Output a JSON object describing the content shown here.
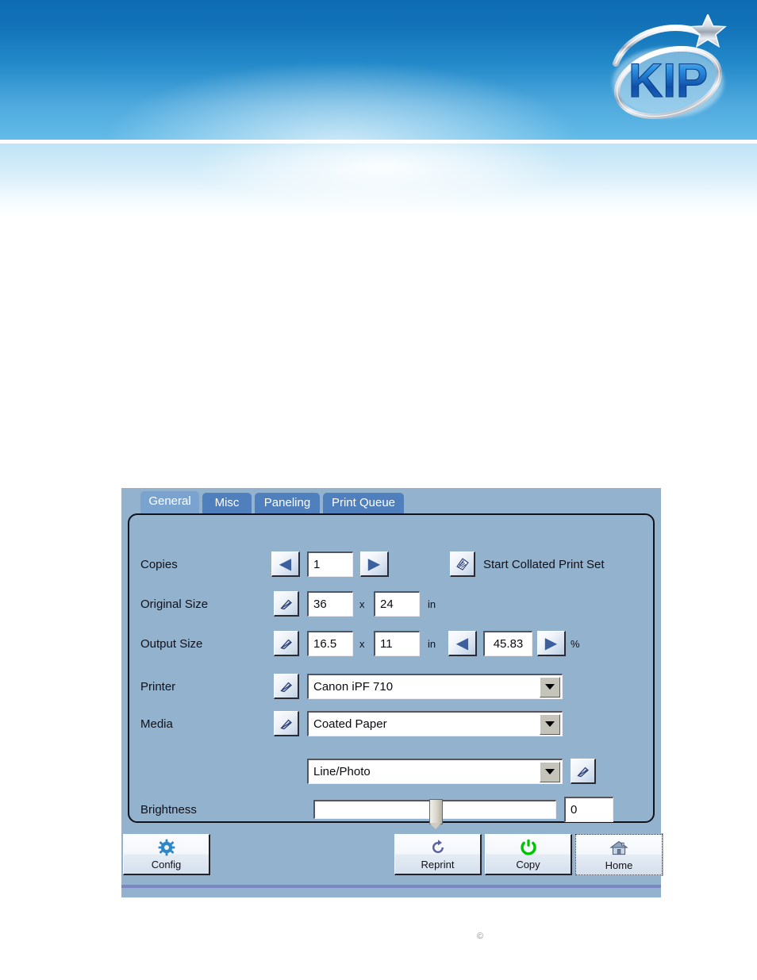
{
  "brand": {
    "logo_text": "KIP",
    "logo_name": "kip-logo"
  },
  "panel": {
    "tabs": [
      {
        "label": "General",
        "active": true
      },
      {
        "label": "Misc",
        "active": false
      },
      {
        "label": "Paneling",
        "active": false
      },
      {
        "label": "Print Queue",
        "active": false
      }
    ],
    "rows": {
      "copies": {
        "label": "Copies",
        "value": "1",
        "prev_icon": "left-arrow-icon",
        "next_icon": "right-arrow-icon",
        "collate_label": "Start Collated Print Set",
        "collate_icon": "stacked-pages-icon"
      },
      "original_size": {
        "label": "Original Size",
        "width": "36",
        "height": "24",
        "unit": "in",
        "separator": "x",
        "edit_icon": "pencil-edit-icon"
      },
      "output_size": {
        "label": "Output Size",
        "width": "16.5",
        "height": "11",
        "unit": "in",
        "separator": "x",
        "zoom": "45.83",
        "zoom_unit": "%",
        "edit_icon": "pencil-edit-icon",
        "dec_icon": "left-arrow-icon",
        "inc_icon": "right-arrow-icon"
      },
      "printer": {
        "label": "Printer",
        "value": "Canon iPF 710",
        "edit_icon": "pencil-edit-icon",
        "dropdown_icon": "chevron-down-icon"
      },
      "media": {
        "label": "Media",
        "value": "Coated Paper",
        "edit_icon": "pencil-edit-icon",
        "dropdown_icon": "chevron-down-icon"
      },
      "image_type": {
        "label": "",
        "value": "Line/Photo",
        "edit_icon": "pencil-edit-icon",
        "dropdown_icon": "chevron-down-icon"
      },
      "brightness": {
        "label": "Brightness",
        "value": "0",
        "slider_percent": 50
      }
    },
    "commands": [
      {
        "label": "Config",
        "icon": "gear-icon",
        "focused": false
      },
      {
        "label": "Reprint",
        "icon": "reprint-refresh-icon",
        "focused": false
      },
      {
        "label": "Copy",
        "icon": "copy-power-icon",
        "focused": false
      },
      {
        "label": "Home",
        "icon": "home-house-icon",
        "focused": true
      }
    ]
  },
  "footer": {
    "copyright_mark": "©"
  },
  "colors": {
    "banner_blue_dark": "#0d6cb4",
    "banner_blue_light": "#62bbe8",
    "panel_bg": "#93b2ce",
    "tab_inactive": "#4f7fbc",
    "tab_active": "#7ba3cf",
    "logo_blue": "#1a6fc4",
    "copy_green": "#00c400",
    "reprint_purple": "#5a5f9e",
    "gear_blue": "#2f86c8",
    "cmdbar_line": "#7d86c4"
  }
}
